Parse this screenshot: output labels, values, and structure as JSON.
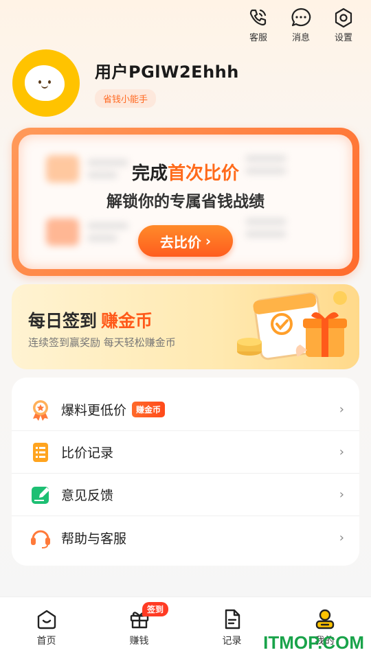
{
  "top_actions": [
    {
      "label": "客服",
      "icon": "phone-icon"
    },
    {
      "label": "消息",
      "icon": "message-icon"
    },
    {
      "label": "设置",
      "icon": "settings-icon"
    }
  ],
  "profile": {
    "username": "用户PGlW2Ehhh",
    "tag": "省钱小能手"
  },
  "compare_card": {
    "title_prefix": "完成",
    "title_highlight": "首次比价",
    "subtitle": "解锁你的专属省钱战绩",
    "button_label": "去比价",
    "button_arrow": "›"
  },
  "signin": {
    "title": "每日签到",
    "title_highlight": "赚金币",
    "subtitle": "连续签到赢奖励 每天轻松赚金币"
  },
  "menu": [
    {
      "label": "爆料更低价",
      "badge": "赚金币",
      "icon": "award-icon"
    },
    {
      "label": "比价记录",
      "icon": "list-icon"
    },
    {
      "label": "意见反馈",
      "icon": "edit-icon"
    },
    {
      "label": "帮助与客服",
      "icon": "headset-icon"
    }
  ],
  "menu_arrow": "›",
  "tabs": [
    {
      "label": "首页",
      "icon": "home-icon"
    },
    {
      "label": "赚钱",
      "icon": "gift-icon",
      "badge": "签到"
    },
    {
      "label": "记录",
      "icon": "document-icon"
    },
    {
      "label": "我的",
      "icon": "profile-icon"
    }
  ],
  "watermark": "ITMOP.COM",
  "colors": {
    "accent": "#ff6a1a",
    "avatar": "#ffc300",
    "badge": "#ff3b24"
  }
}
